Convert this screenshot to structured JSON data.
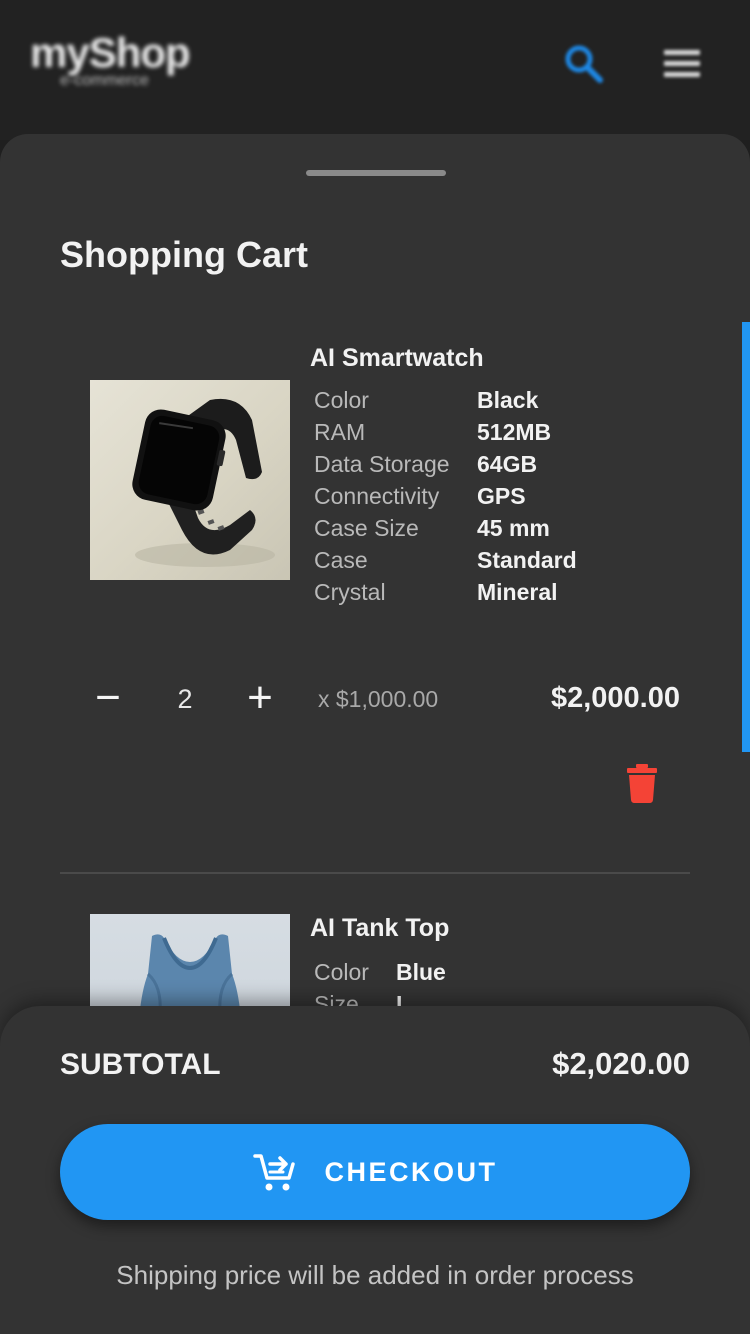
{
  "header": {
    "logo_title": "myShop",
    "logo_subtitle": "e-commerce",
    "search_icon": "search-icon",
    "menu_icon": "hamburger-menu-icon"
  },
  "cart": {
    "title": "Shopping Cart",
    "items": [
      {
        "name": "AI Smartwatch",
        "image_icon": "smartwatch-image",
        "specs": [
          {
            "label": "Color",
            "value": "Black"
          },
          {
            "label": "RAM",
            "value": "512MB"
          },
          {
            "label": "Data Storage",
            "value": "64GB"
          },
          {
            "label": "Connectivity",
            "value": "GPS"
          },
          {
            "label": "Case Size",
            "value": "45 mm"
          },
          {
            "label": "Case",
            "value": "Standard"
          },
          {
            "label": "Crystal",
            "value": "Mineral"
          }
        ],
        "minus_label": "−",
        "quantity": "2",
        "plus_label": "+",
        "unit_price": "x $1,000.00",
        "line_total": "$2,000.00",
        "delete_icon": "trash-icon"
      },
      {
        "name": "AI Tank Top",
        "image_icon": "tank-top-image",
        "specs": [
          {
            "label": "Color",
            "value": "Blue"
          },
          {
            "label": "Size",
            "value": "L"
          }
        ]
      }
    ]
  },
  "footer": {
    "subtotal_label": "SUBTOTAL",
    "subtotal_value": "$2,020.00",
    "checkout_label": "CHECKOUT",
    "checkout_icon": "cart-arrow-icon",
    "shipping_note": "Shipping price will be added in order process"
  },
  "colors": {
    "accent": "#2196f3",
    "background": "#333333",
    "delete": "#f44336"
  }
}
